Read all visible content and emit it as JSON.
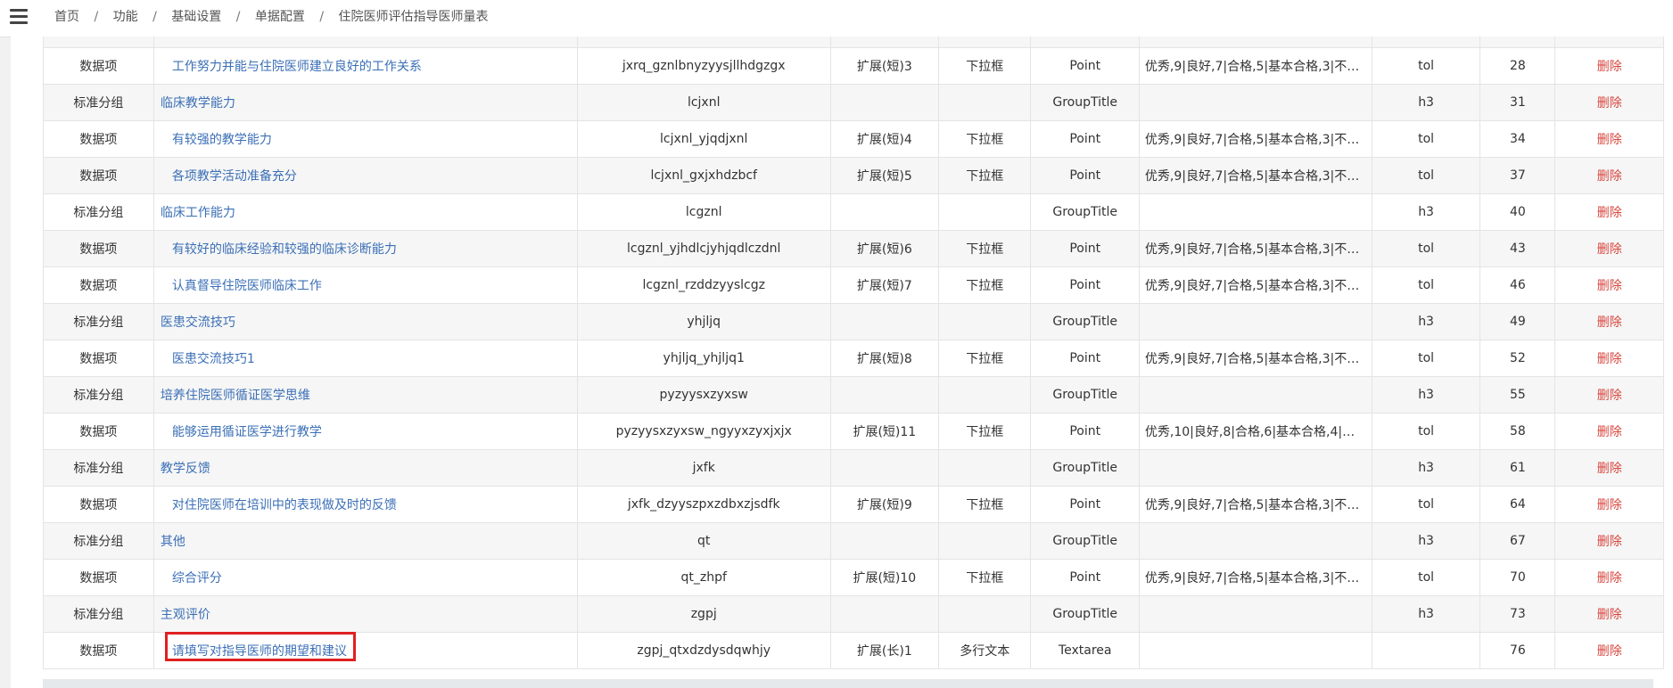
{
  "breadcrumb": [
    "首页",
    "功能",
    "基础设置",
    "单据配置",
    "住院医师评估指导医师量表"
  ],
  "rows": [
    {
      "type": "数据项",
      "kind": "point",
      "name": "工作努力并能与住院医师建立良好的工作关系",
      "code": "jxrq_gznlbnyzyysjllhdgzgx",
      "ext": "扩展(短)3",
      "ctrl": "下拉框",
      "style": "Point",
      "options": "优秀,9|良好,7|合格,5|基本合格,3|不合...",
      "tag": "tol",
      "order": "28",
      "action": "删除"
    },
    {
      "type": "标准分组",
      "kind": "group",
      "name": "临床教学能力",
      "code": "lcjxnl",
      "ext": "",
      "ctrl": "",
      "style": "GroupTitle",
      "options": "",
      "tag": "h3",
      "order": "31",
      "action": "删除"
    },
    {
      "type": "数据项",
      "kind": "point",
      "name": "有较强的教学能力",
      "code": "lcjxnl_yjqdjxnl",
      "ext": "扩展(短)4",
      "ctrl": "下拉框",
      "style": "Point",
      "options": "优秀,9|良好,7|合格,5|基本合格,3|不合...",
      "tag": "tol",
      "order": "34",
      "action": "删除"
    },
    {
      "type": "数据项",
      "kind": "point",
      "name": "各项教学活动准备充分",
      "code": "lcjxnl_gxjxhdzbcf",
      "ext": "扩展(短)5",
      "ctrl": "下拉框",
      "style": "Point",
      "options": "优秀,9|良好,7|合格,5|基本合格,3|不合...",
      "tag": "tol",
      "order": "37",
      "action": "删除"
    },
    {
      "type": "标准分组",
      "kind": "group",
      "name": "临床工作能力",
      "code": "lcgznl",
      "ext": "",
      "ctrl": "",
      "style": "GroupTitle",
      "options": "",
      "tag": "h3",
      "order": "40",
      "action": "删除"
    },
    {
      "type": "数据项",
      "kind": "point",
      "name": "有较好的临床经验和较强的临床诊断能力",
      "code": "lcgznl_yjhdlcjyhjqdlczdnl",
      "ext": "扩展(短)6",
      "ctrl": "下拉框",
      "style": "Point",
      "options": "优秀,9|良好,7|合格,5|基本合格,3|不合...",
      "tag": "tol",
      "order": "43",
      "action": "删除"
    },
    {
      "type": "数据项",
      "kind": "point",
      "name": "认真督导住院医师临床工作",
      "code": "lcgznl_rzddzyyslcgz",
      "ext": "扩展(短)7",
      "ctrl": "下拉框",
      "style": "Point",
      "options": "优秀,9|良好,7|合格,5|基本合格,3|不合...",
      "tag": "tol",
      "order": "46",
      "action": "删除"
    },
    {
      "type": "标准分组",
      "kind": "group",
      "name": "医患交流技巧",
      "code": "yhjljq",
      "ext": "",
      "ctrl": "",
      "style": "GroupTitle",
      "options": "",
      "tag": "h3",
      "order": "49",
      "action": "删除"
    },
    {
      "type": "数据项",
      "kind": "point",
      "name": "医患交流技巧1",
      "code": "yhjljq_yhjljq1",
      "ext": "扩展(短)8",
      "ctrl": "下拉框",
      "style": "Point",
      "options": "优秀,9|良好,7|合格,5|基本合格,3|不合...",
      "tag": "tol",
      "order": "52",
      "action": "删除"
    },
    {
      "type": "标准分组",
      "kind": "group",
      "name": "培养住院医师循证医学思维",
      "code": "pyzyysxzyxsw",
      "ext": "",
      "ctrl": "",
      "style": "GroupTitle",
      "options": "",
      "tag": "h3",
      "order": "55",
      "action": "删除"
    },
    {
      "type": "数据项",
      "kind": "point",
      "name": "能够运用循证医学进行教学",
      "code": "pyzyysxzyxsw_ngyyxzyxjxjx",
      "ext": "扩展(短)11",
      "ctrl": "下拉框",
      "style": "Point",
      "options": "优秀,10|良好,8|合格,6|基本合格,4|不...",
      "tag": "tol",
      "order": "58",
      "action": "删除"
    },
    {
      "type": "标准分组",
      "kind": "group",
      "name": "教学反馈",
      "code": "jxfk",
      "ext": "",
      "ctrl": "",
      "style": "GroupTitle",
      "options": "",
      "tag": "h3",
      "order": "61",
      "action": "删除"
    },
    {
      "type": "数据项",
      "kind": "point",
      "name": "对住院医师在培训中的表现做及时的反馈",
      "code": "jxfk_dzyyszpxzdbxzjsdfk",
      "ext": "扩展(短)9",
      "ctrl": "下拉框",
      "style": "Point",
      "options": "优秀,9|良好,7|合格,5|基本合格,3|不合...",
      "tag": "tol",
      "order": "64",
      "action": "删除"
    },
    {
      "type": "标准分组",
      "kind": "group",
      "name": "其他",
      "code": "qt",
      "ext": "",
      "ctrl": "",
      "style": "GroupTitle",
      "options": "",
      "tag": "h3",
      "order": "67",
      "action": "删除"
    },
    {
      "type": "数据项",
      "kind": "point",
      "name": "综合评分",
      "code": "qt_zhpf",
      "ext": "扩展(短)10",
      "ctrl": "下拉框",
      "style": "Point",
      "options": "优秀,9|良好,7|合格,5|基本合格,3|不合...",
      "tag": "tol",
      "order": "70",
      "action": "删除"
    },
    {
      "type": "标准分组",
      "kind": "group",
      "name": "主观评价",
      "code": "zgpj",
      "ext": "",
      "ctrl": "",
      "style": "GroupTitle",
      "options": "",
      "tag": "h3",
      "order": "73",
      "action": "删除"
    },
    {
      "type": "数据项",
      "kind": "point",
      "name": "请填写对指导医师的期望和建议",
      "code": "zgpj_qtxdzdysdqwhjy",
      "ext": "扩展(长)1",
      "ctrl": "多行文本",
      "style": "Textarea",
      "options": "",
      "tag": "",
      "order": "76",
      "action": "删除"
    }
  ],
  "colors": {
    "link": "#3b6fb6",
    "delete": "#d9453d",
    "highlight": "#e02020",
    "row_alt": "#f6f6f6"
  }
}
